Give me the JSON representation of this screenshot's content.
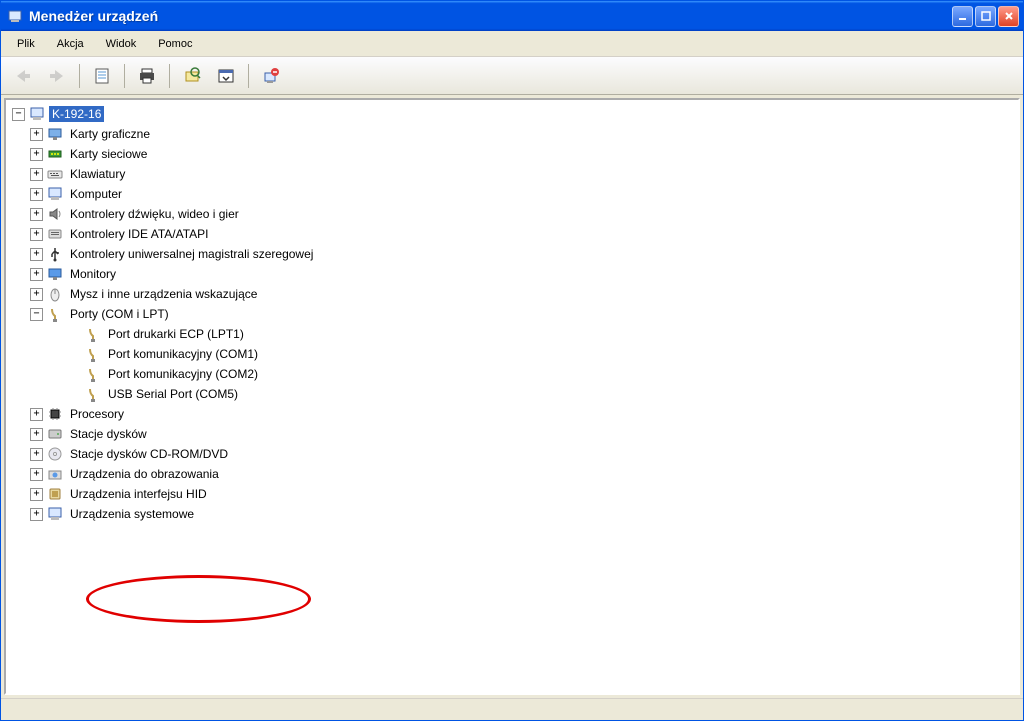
{
  "window": {
    "title": "Menedżer urządzeń"
  },
  "menu": {
    "file": "Plik",
    "action": "Akcja",
    "view": "Widok",
    "help": "Pomoc"
  },
  "tree": {
    "root": "K-192-16",
    "items": [
      {
        "label": "Karty graficzne",
        "expanded": false
      },
      {
        "label": "Karty sieciowe",
        "expanded": false
      },
      {
        "label": "Klawiatury",
        "expanded": false
      },
      {
        "label": "Komputer",
        "expanded": false
      },
      {
        "label": "Kontrolery dźwięku, wideo i gier",
        "expanded": false
      },
      {
        "label": "Kontrolery IDE ATA/ATAPI",
        "expanded": false
      },
      {
        "label": "Kontrolery uniwersalnej magistrali szeregowej",
        "expanded": false
      },
      {
        "label": "Monitory",
        "expanded": false
      },
      {
        "label": "Mysz i inne urządzenia wskazujące",
        "expanded": false
      },
      {
        "label": "Porty (COM i LPT)",
        "expanded": true,
        "children": [
          {
            "label": "Port drukarki ECP (LPT1)"
          },
          {
            "label": "Port komunikacyjny (COM1)"
          },
          {
            "label": "Port komunikacyjny (COM2)"
          },
          {
            "label": "USB Serial Port (COM5)",
            "highlighted": true
          }
        ]
      },
      {
        "label": "Procesory",
        "expanded": false
      },
      {
        "label": "Stacje dysków",
        "expanded": false
      },
      {
        "label": "Stacje dysków CD-ROM/DVD",
        "expanded": false
      },
      {
        "label": "Urządzenia do obrazowania",
        "expanded": false
      },
      {
        "label": "Urządzenia interfejsu HID",
        "expanded": false
      },
      {
        "label": "Urządzenia systemowe",
        "expanded": false
      }
    ]
  }
}
